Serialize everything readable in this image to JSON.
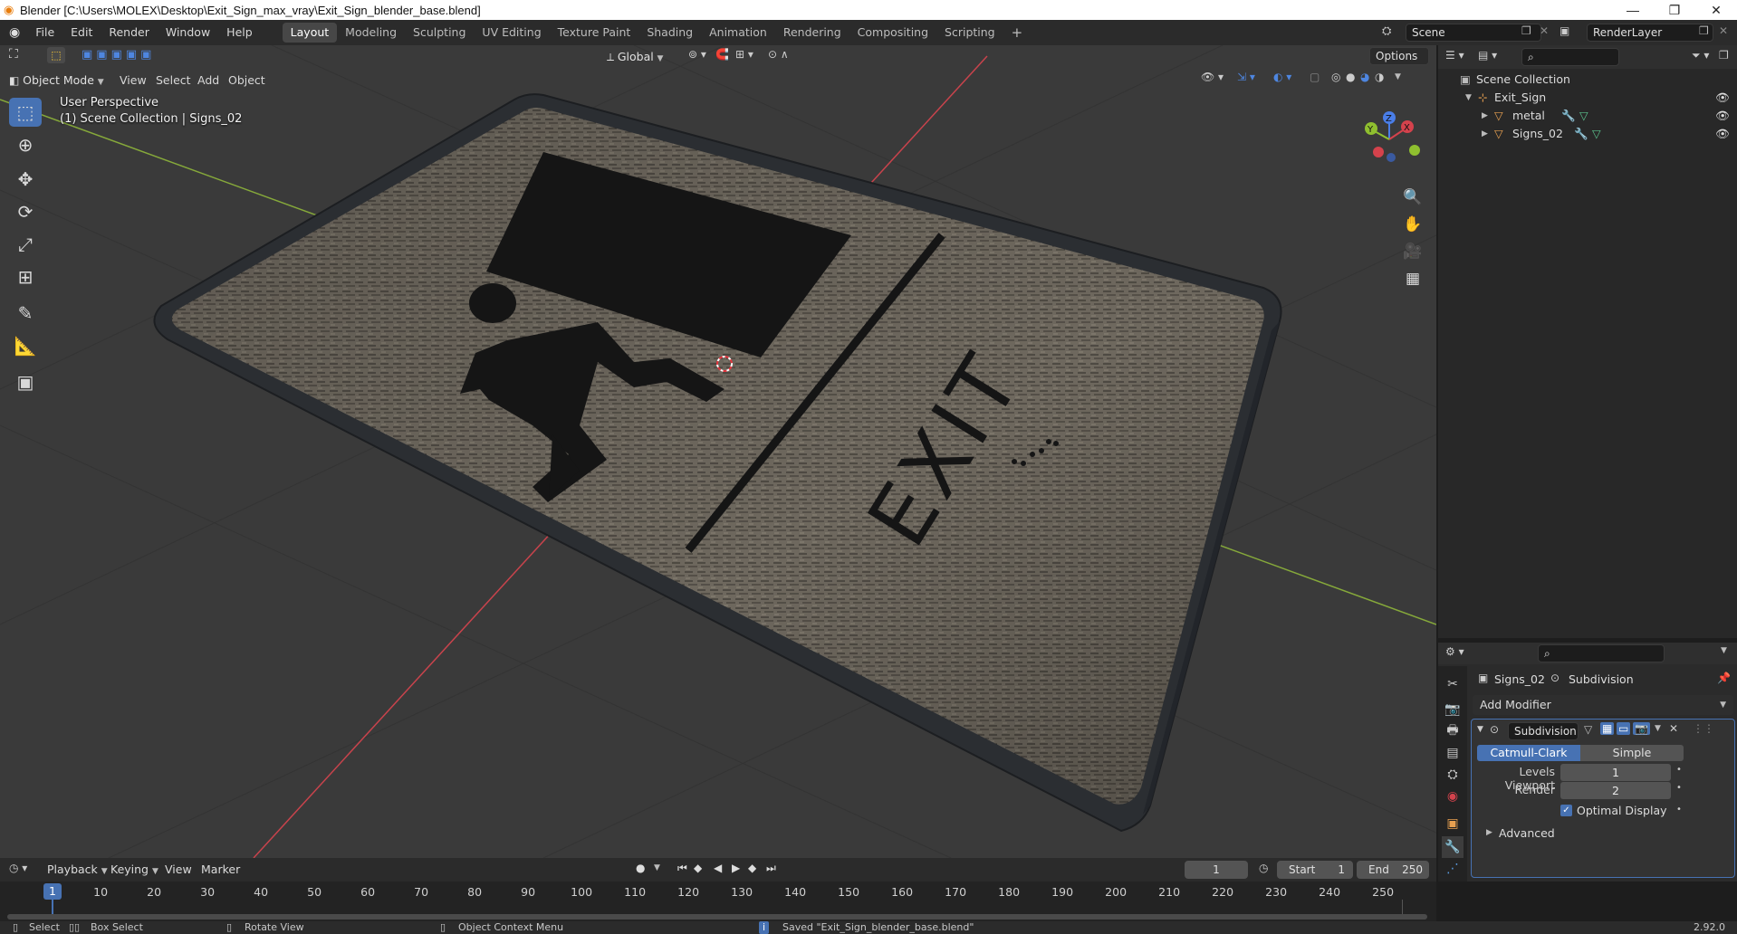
{
  "window": {
    "title": "Blender [C:\\Users\\MOLEX\\Desktop\\Exit_Sign_max_vray\\Exit_Sign_blender_base.blend]",
    "minimize_icon": "minimize-icon",
    "maximize_icon": "restore-icon",
    "close_icon": "close-icon"
  },
  "menu": [
    "File",
    "Edit",
    "Render",
    "Window",
    "Help"
  ],
  "workspaces": [
    "Layout",
    "Modeling",
    "Sculpting",
    "UV Editing",
    "Texture Paint",
    "Shading",
    "Animation",
    "Rendering",
    "Compositing",
    "Scripting"
  ],
  "active_workspace": "Layout",
  "scene": {
    "name": "Scene",
    "view_layer": "RenderLayer"
  },
  "viewport": {
    "mode": "Object Mode",
    "header_menus": [
      "View",
      "Select",
      "Add",
      "Object"
    ],
    "transform_orientation": "Global",
    "options_label": "Options",
    "perspective": "User Perspective",
    "collection_info": "(1) Scene Collection | Signs_02",
    "gizmo_axes": {
      "x": "X",
      "y": "Y",
      "z": "Z"
    },
    "sign_text": "EXIT",
    "tools": [
      "select-box-icon",
      "cursor-icon",
      "move-icon",
      "rotate-icon",
      "scale-icon",
      "transform-icon",
      "annotate-icon",
      "measure-icon",
      "add-cube-icon"
    ],
    "nav_controls": [
      "zoom-icon",
      "pan-hand-icon",
      "camera-view-icon",
      "ortho-grid-icon"
    ]
  },
  "outliner": {
    "root": "Scene Collection",
    "items": [
      {
        "name": "Exit_Sign",
        "type": "empty",
        "level": 1
      },
      {
        "name": "metal",
        "type": "mesh",
        "level": 2
      },
      {
        "name": "Signs_02",
        "type": "mesh",
        "level": 2
      }
    ]
  },
  "properties": {
    "object": "Signs_02",
    "modifier_context": "Subdivision",
    "add_modifier": "Add Modifier",
    "modifier_name": "Subdivision",
    "algorithms": [
      "Catmull-Clark",
      "Simple"
    ],
    "active_algorithm": "Catmull-Clark",
    "levels_viewport_label": "Levels Viewport",
    "levels_viewport": "1",
    "render_label": "Render",
    "render_levels": "2",
    "optimal_display_label": "Optimal Display",
    "optimal_display": true,
    "advanced_label": "Advanced"
  },
  "timeline": {
    "menus": [
      "Playback",
      "Keying",
      "View",
      "Marker"
    ],
    "current_frame": "1",
    "start_label": "Start",
    "start": "1",
    "end_label": "End",
    "end": "250",
    "ticks": [
      "1",
      "10",
      "20",
      "30",
      "40",
      "50",
      "60",
      "70",
      "80",
      "90",
      "100",
      "110",
      "120",
      "130",
      "140",
      "150",
      "160",
      "170",
      "180",
      "190",
      "200",
      "210",
      "220",
      "230",
      "240",
      "250"
    ]
  },
  "status": {
    "select": "Select",
    "box_select": "Box Select",
    "rotate_view": "Rotate View",
    "context_menu": "Object Context Menu",
    "message": "Saved \"Exit_Sign_blender_base.blend\"",
    "version": "2.92.0"
  },
  "colors": {
    "accent": "#4772b3",
    "x_axis": "#d4424c",
    "y_axis": "#8fbf2f",
    "z_axis": "#4a7ee8",
    "header_bg": "#2b2b2b"
  }
}
